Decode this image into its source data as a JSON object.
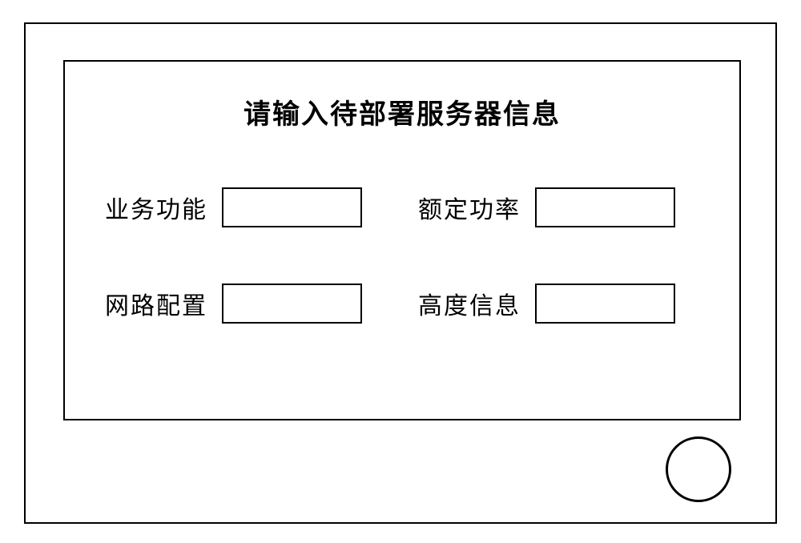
{
  "panel": {
    "title": "请输入待部署服务器信息"
  },
  "fields": {
    "business_function": {
      "label": "业务功能",
      "value": ""
    },
    "rated_power": {
      "label": "额定功率",
      "value": ""
    },
    "network_config": {
      "label": "网路配置",
      "value": ""
    },
    "height_info": {
      "label": "高度信息",
      "value": ""
    }
  }
}
